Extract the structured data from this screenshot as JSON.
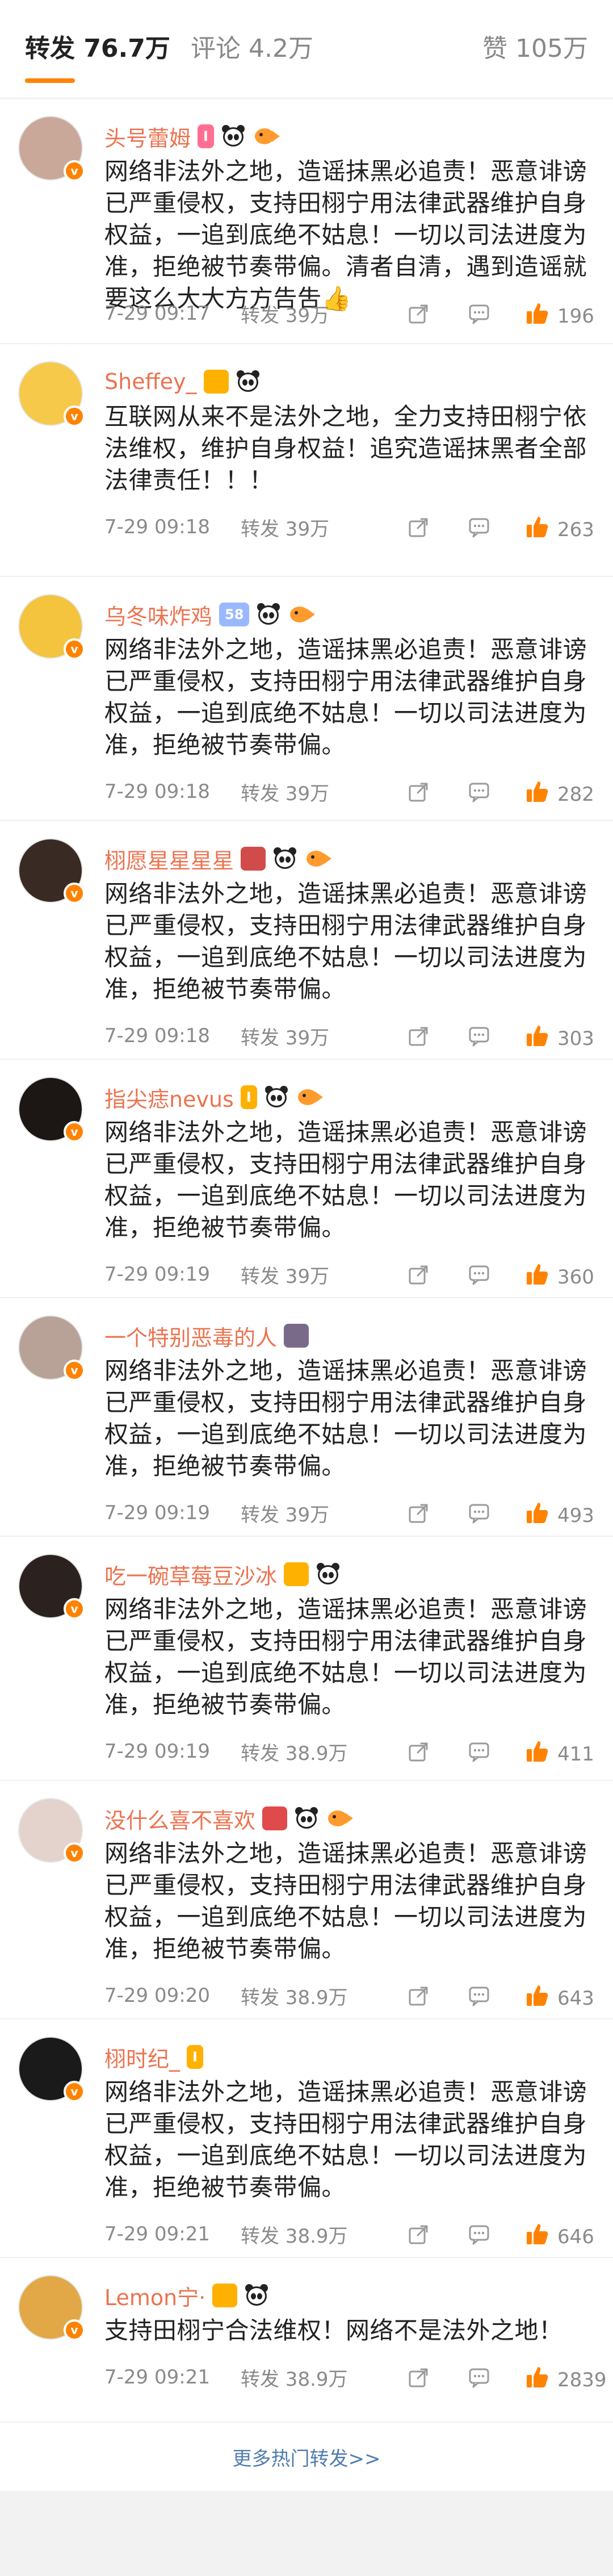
{
  "tabs": {
    "repost": "转发 76.7万",
    "comment": "评论 4.2万",
    "like": "赞 105万"
  },
  "reposts": [
    {
      "name": "头号蕾姆",
      "badge": "I",
      "content": "网络非法外之地，造谣抹黑必追责！恶意诽谤已严重侵权，支持田栩宁用法律武器维护自身权益，一追到底绝不姑息！一切以司法进度为准，拒绝被节奏带偏。清者自清，遇到造谣就要这么大大方方告吿👍",
      "time": "7-29 09:17",
      "repost": "转发 39万",
      "likes": "196"
    },
    {
      "name": "Sheffey_",
      "badge": "",
      "content": "互联网从来不是法外之地，全力支持田栩宁依法维权，维护自身权益！追究造谣抹黑者全部法律责任！！！",
      "time": "7-29 09:18",
      "repost": "转发 39万",
      "likes": "263"
    },
    {
      "name": "乌冬味炸鸡",
      "badge": "58",
      "content": "网络非法外之地，造谣抹黑必追责！恶意诽谤已严重侵权，支持田栩宁用法律武器维护自身权益，一追到底绝不姑息！一切以司法进度为准，拒绝被节奏带偏。",
      "time": "7-29 09:18",
      "repost": "转发 39万",
      "likes": "282"
    },
    {
      "name": "栩愿星星星星",
      "badge": "",
      "content": "网络非法外之地，造谣抹黑必追责！恶意诽谤已严重侵权，支持田栩宁用法律武器维护自身权益，一追到底绝不姑息！一切以司法进度为准，拒绝被节奏带偏。",
      "time": "7-29 09:18",
      "repost": "转发 39万",
      "likes": "303"
    },
    {
      "name": "指尖痣nevus",
      "badge": "I",
      "content": "网络非法外之地，造谣抹黑必追责！恶意诽谤已严重侵权，支持田栩宁用法律武器维护自身权益，一追到底绝不姑息！一切以司法进度为准，拒绝被节奏带偏。",
      "time": "7-29 09:19",
      "repost": "转发 39万",
      "likes": "360"
    },
    {
      "name": "一个特别恶毒的人",
      "badge": "",
      "content": "网络非法外之地，造谣抹黑必追责！恶意诽谤已严重侵权，支持田栩宁用法律武器维护自身权益，一追到底绝不姑息！一切以司法进度为准，拒绝被节奏带偏。",
      "time": "7-29 09:19",
      "repost": "转发 39万",
      "likes": "493"
    },
    {
      "name": "吃一碗草莓豆沙冰",
      "badge": "",
      "content": "网络非法外之地，造谣抹黑必追责！恶意诽谤已严重侵权，支持田栩宁用法律武器维护自身权益，一追到底绝不姑息！一切以司法进度为准，拒绝被节奏带偏。",
      "time": "7-29 09:19",
      "repost": "转发 38.9万",
      "likes": "411"
    },
    {
      "name": "没什么喜不喜欢",
      "badge": "",
      "content": "网络非法外之地，造谣抹黑必追责！恶意诽谤已严重侵权，支持田栩宁用法律武器维护自身权益，一追到底绝不姑息！一切以司法进度为准，拒绝被节奏带偏。",
      "time": "7-29 09:20",
      "repost": "转发 38.9万",
      "likes": "643"
    },
    {
      "name": "栩时纪_",
      "badge": "I",
      "content": "网络非法外之地，造谣抹黑必追责！恶意诽谤已严重侵权，支持田栩宁用法律武器维护自身权益，一追到底绝不姑息！一切以司法进度为准，拒绝被节奏带偏。",
      "time": "7-29 09:21",
      "repost": "转发 38.9万",
      "likes": "646"
    },
    {
      "name": "Lemon宁·",
      "badge": "",
      "content": "支持田栩宁合法维权！网络不是法外之地！",
      "time": "7-29 09:21",
      "repost": "转发 38.9万",
      "likes": "2839"
    }
  ],
  "more_link": "更多热门转发>>",
  "colors": {
    "accent": "#ff8200",
    "name": "#eb7350",
    "link": "#507daf",
    "like": "#ff8200"
  },
  "icons": [
    "v-verified-icon",
    "panda-icon",
    "fish-icon",
    "share-icon",
    "comment-icon",
    "thumbs-up-icon"
  ]
}
